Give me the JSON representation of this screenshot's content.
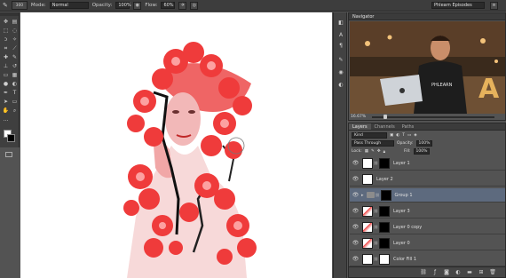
{
  "options_bar": {
    "brush_size": "300",
    "mode_label": "Mode:",
    "mode_value": "Normal",
    "opacity_label": "Opacity:",
    "opacity_value": "100%",
    "flow_label": "Flow:",
    "flow_value": "60%",
    "workspace_value": "Phlearn Episodes"
  },
  "navigator": {
    "tab_label": "Navigator",
    "zoom_value": "16.67%",
    "zoom_fraction": 0.1,
    "thumbnail_shirt_text": "PHLEARN",
    "thumbnail_letter": "A"
  },
  "layers_panel": {
    "tabs": [
      {
        "label": "Layers",
        "active": true
      },
      {
        "label": "Channels",
        "active": false
      },
      {
        "label": "Paths",
        "active": false
      }
    ],
    "filter_kind": "Kind",
    "blend_mode": "Pass Through",
    "opacity_label": "Opacity:",
    "opacity_value": "100%",
    "lock_label": "Lock:",
    "fill_label": "Fill:",
    "fill_value": "100%",
    "layers": [
      {
        "name": "Layer 1",
        "selected": false,
        "type": "masked"
      },
      {
        "name": "Layer 2",
        "selected": false,
        "type": "plain"
      },
      {
        "name": "Group 1",
        "selected": true,
        "type": "group"
      },
      {
        "name": "Layer 3",
        "selected": false,
        "type": "masked"
      },
      {
        "name": "Layer 0 copy",
        "selected": false,
        "type": "masked"
      },
      {
        "name": "Layer 0",
        "selected": false,
        "type": "masked"
      },
      {
        "name": "Color Fill 1",
        "selected": false,
        "type": "fill"
      }
    ]
  },
  "colors": {
    "panel_bg": "#535353",
    "selected_layer": "#5d6a7e",
    "flower_red": "#ef3b3b",
    "foreground": "#ffffff",
    "background": "#000000"
  },
  "icons": [
    "brush-icon",
    "move-icon",
    "marquee-icon",
    "lasso-icon",
    "eye-icon",
    "folder-icon",
    "link-icon",
    "fx-icon",
    "mask-icon",
    "adjustment-icon",
    "new-group-icon",
    "new-layer-icon",
    "trash-icon"
  ]
}
